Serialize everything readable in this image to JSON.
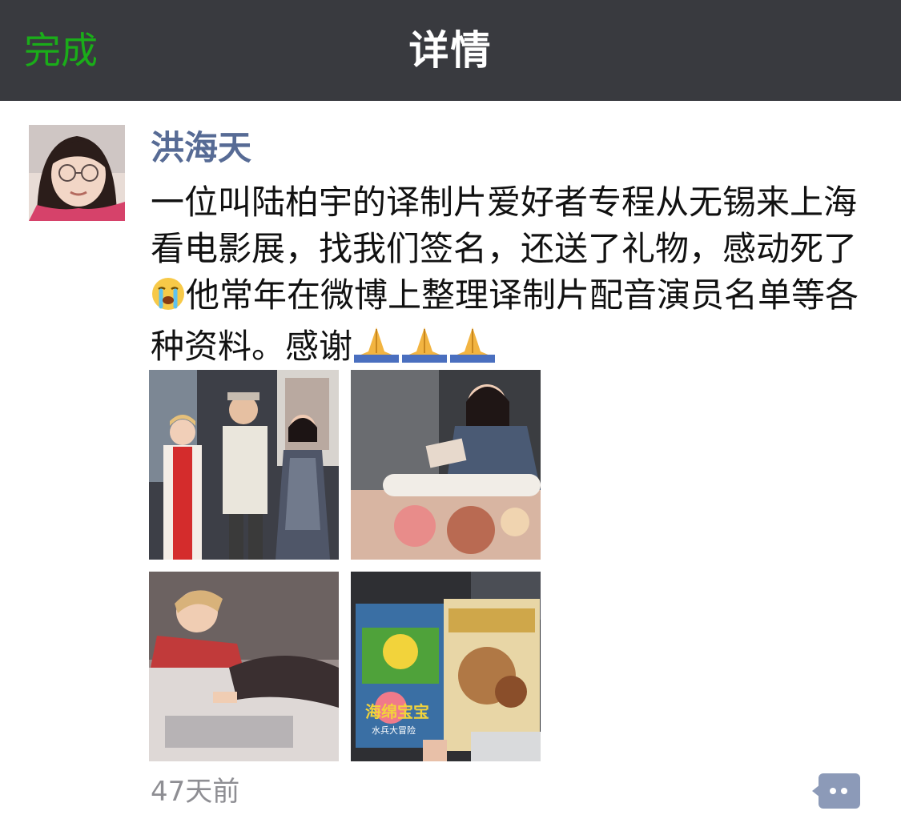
{
  "navbar": {
    "done_label": "完成",
    "title": "详情"
  },
  "post": {
    "author": "洪海天",
    "text_part1": "一位叫陆柏宇的译制片爱好者专程从无锡来上海看电影展，找我们签名，还送了礼物，感动死了",
    "text_part2": "他常年在微博上整理译制片配音演员名单等各种资料。感谢",
    "emojis": {
      "crying": "loudly-crying-face-icon",
      "thanks": "folded-hands-icon",
      "thanks_count": 3
    },
    "timestamp": "47天前",
    "photos": [
      {
        "subject": "three-people-group-photo"
      },
      {
        "subject": "woman-signing-poster"
      },
      {
        "subject": "woman-signing-on-table"
      },
      {
        "subject": "dvd-gifts"
      }
    ]
  },
  "poster_text": {
    "dvd_left_title": "海绵宝宝",
    "dvd_left_sub": "水兵大冒险"
  },
  "colors": {
    "navbar_bg": "#393a3f",
    "done_green": "#1aad19",
    "author_blue": "#576b95",
    "timestamp_gray": "#8e8e93",
    "comment_btn": "#8c9ab8"
  }
}
